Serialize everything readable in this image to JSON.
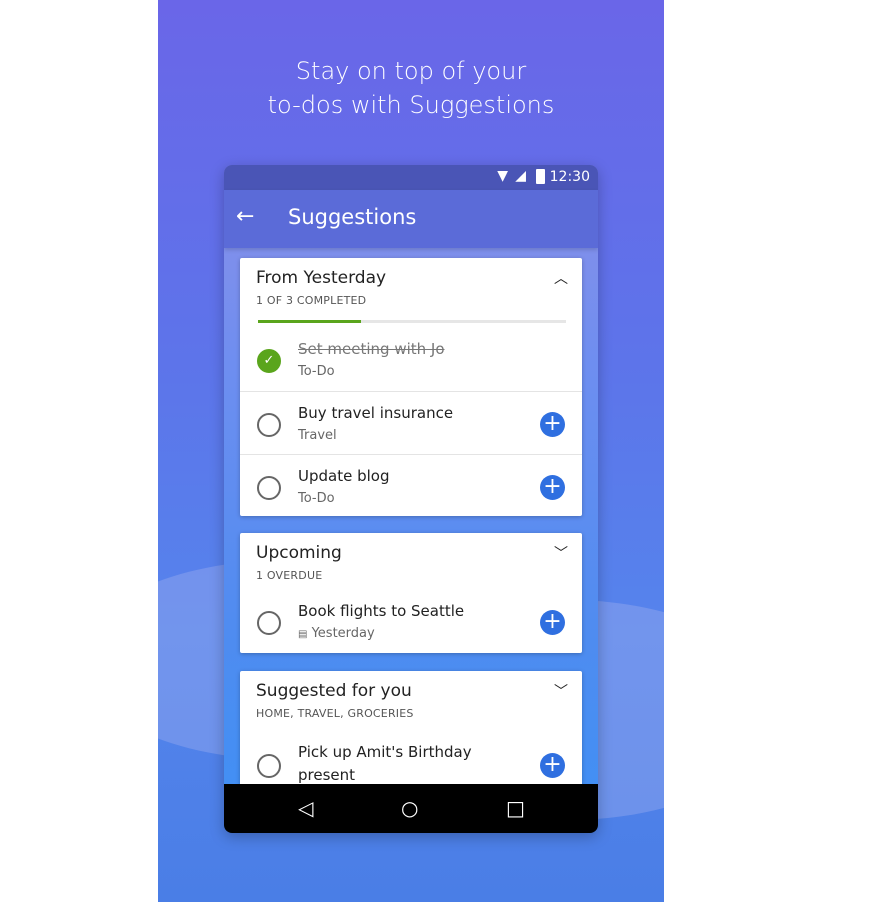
{
  "headline": [
    "Stay on top of your",
    "to-dos with Suggestions"
  ],
  "status": {
    "time": "12:30"
  },
  "appbar": {
    "title": "Suggestions"
  },
  "cards": [
    {
      "title": "From Yesterday",
      "subtitle": "1 OF 3 COMPLETED",
      "progress": 0.333,
      "expanded": true,
      "items": [
        {
          "title": "Set meeting with Jo",
          "list": "To-Do",
          "completed": true
        },
        {
          "title": "Buy travel insurance",
          "list": "Travel",
          "completed": false
        },
        {
          "title": "Update blog",
          "list": "To-Do",
          "completed": false
        }
      ]
    },
    {
      "title": "Upcoming",
      "subtitle": "1 OVERDUE",
      "expanded": false,
      "items": [
        {
          "title": "Book flights to Seattle",
          "due": "Yesterday",
          "completed": false
        }
      ]
    },
    {
      "title": "Suggested for you",
      "subtitle": "HOME, TRAVEL, GROCERIES",
      "expanded": false,
      "items": [
        {
          "title": "Pick up Amit's Birthday",
          "title2": "present",
          "completed": false
        }
      ]
    }
  ],
  "colors": {
    "accent": "#2f6fe0",
    "progress": "#5aa51c",
    "appbar": "#5b6bd8"
  }
}
